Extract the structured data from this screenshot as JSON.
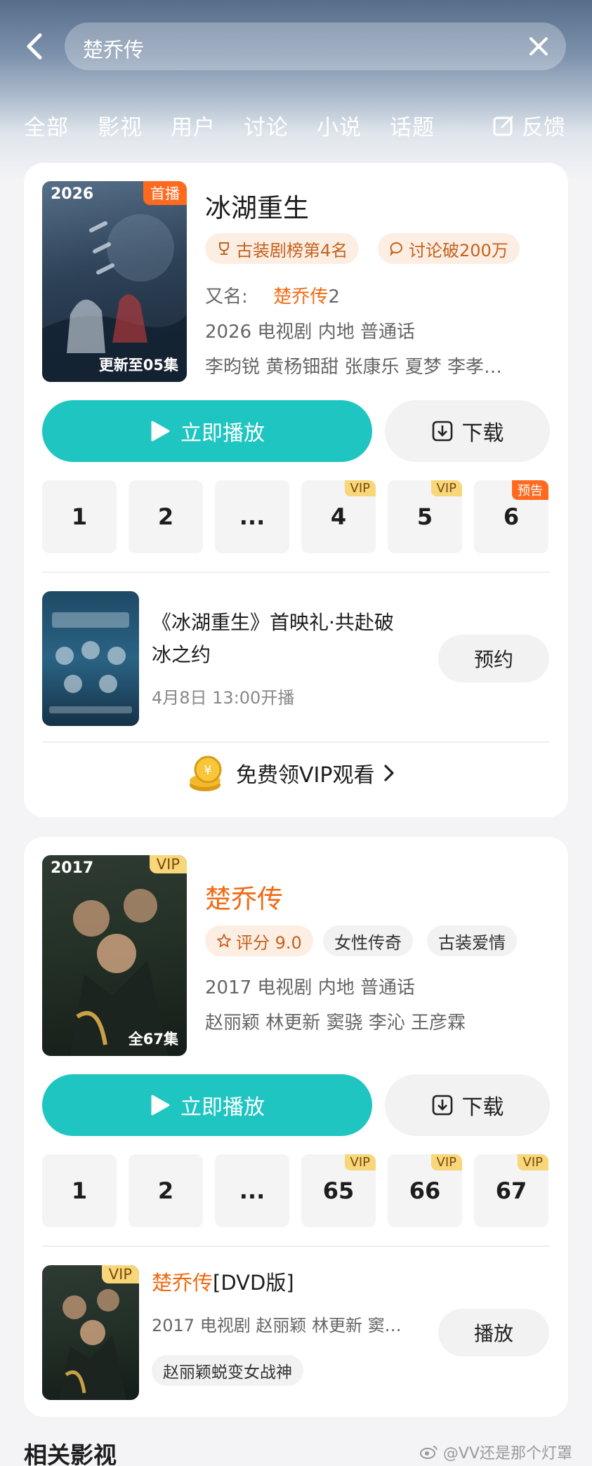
{
  "search": {
    "query": "楚乔传"
  },
  "tabs": [
    "全部",
    "影视",
    "用户",
    "讨论",
    "小说",
    "话题"
  ],
  "feedback_label": "反馈",
  "result1": {
    "poster_year": "2026",
    "poster_badge": "首播",
    "poster_update": "更新至05集",
    "title": "冰湖重生",
    "tag_rank": "古装剧榜第4名",
    "tag_discuss": "讨论破200万",
    "alias_prefix": "又名:",
    "alias_link": "楚乔传",
    "alias_suffix": "2",
    "meta": "2026 电视剧 内地 普通话",
    "cast": "李昀锐 黄杨钿甜 张康乐 夏梦 李孝…",
    "play_label": "立即播放",
    "download_label": "下载",
    "episodes": [
      {
        "label": "1",
        "tag": ""
      },
      {
        "label": "2",
        "tag": ""
      },
      {
        "label": "...",
        "tag": ""
      },
      {
        "label": "4",
        "tag": "VIP"
      },
      {
        "label": "5",
        "tag": "VIP"
      },
      {
        "label": "6",
        "tag": "预告"
      }
    ],
    "reservation": {
      "title_line1": "《冰湖重生》首映礼·共赴破",
      "title_line2": "冰之约",
      "time": "4月8日 13:00开播",
      "button": "预约"
    },
    "vip_free_label": "免费领VIP观看"
  },
  "result2": {
    "poster_year": "2017",
    "poster_badge": "VIP",
    "poster_count": "全67集",
    "title": "楚乔传",
    "tag_score": "评分 9.0",
    "tag_genre1": "女性传奇",
    "tag_genre2": "古装爱情",
    "meta": "2017 电视剧 内地 普通话",
    "cast": "赵丽颖 林更新 窦骁 李沁 王彦霖",
    "play_label": "立即播放",
    "download_label": "下载",
    "episodes": [
      {
        "label": "1",
        "tag": ""
      },
      {
        "label": "2",
        "tag": ""
      },
      {
        "label": "...",
        "tag": ""
      },
      {
        "label": "65",
        "tag": "VIP"
      },
      {
        "label": "66",
        "tag": "VIP"
      },
      {
        "label": "67",
        "tag": "VIP"
      }
    ],
    "dvd": {
      "badge": "VIP",
      "title_link": "楚乔传",
      "title_suffix": "[DVD版]",
      "meta": "2017 电视剧 赵丽颖 林更新 窦…",
      "tag": "赵丽颖蜕变女战神",
      "button": "播放"
    }
  },
  "related_title": "相关影视",
  "watermark": "@VV还是那个灯罩",
  "colors": {
    "accent_teal": "#1ec5c1",
    "accent_orange": "#f26a12",
    "vip_gold": "#f8d67a"
  }
}
